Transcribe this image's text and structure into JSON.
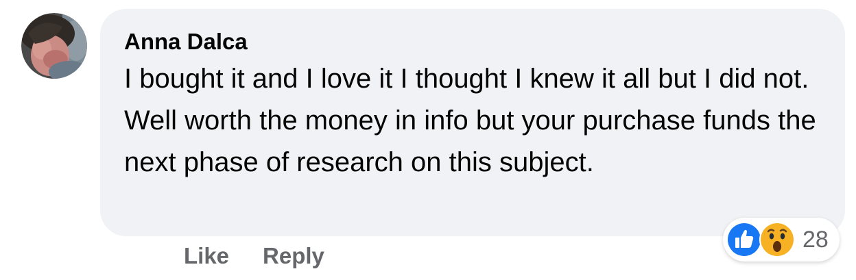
{
  "comment": {
    "author": "Anna Dalca",
    "text": "I bought it and I love it I thought I knew it all but I did not. Well worth the money in info but your purchase funds the next phase of research on this subject."
  },
  "actions": {
    "like_label": "Like",
    "reply_label": "Reply"
  },
  "reactions": {
    "types": [
      "like-icon",
      "wow-icon"
    ],
    "count": "28"
  },
  "colors": {
    "bubble": "#f0f2f5",
    "text": "#050505",
    "secondary": "#65676b",
    "like_blue": "#1877f2",
    "wow_yellow": "#f7b125"
  }
}
